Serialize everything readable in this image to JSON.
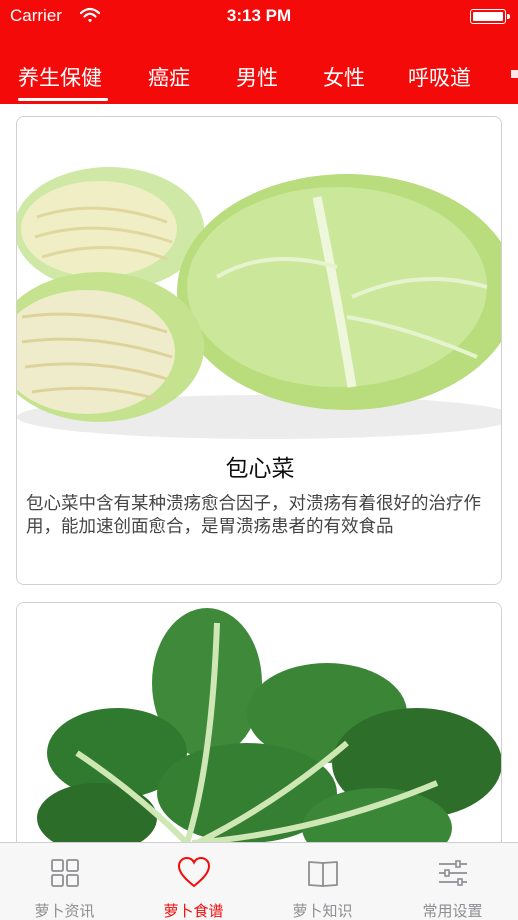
{
  "status_bar": {
    "carrier": "Carrier",
    "time": "3:13 PM"
  },
  "category_tabs": [
    {
      "label": "养生保健",
      "selected": true
    },
    {
      "label": "癌症",
      "selected": false
    },
    {
      "label": "男性",
      "selected": false
    },
    {
      "label": "女性",
      "selected": false
    },
    {
      "label": "呼吸道",
      "selected": false
    }
  ],
  "cards": [
    {
      "title": "包心菜",
      "description": "包心菜中含有某种溃疡愈合因子，对溃疡有着很好的治疗作用，能加速创面愈合，是胃溃疡患者的有效食品",
      "image_subject": "cabbage"
    },
    {
      "title": "",
      "description": "",
      "image_subject": "spinach"
    }
  ],
  "tab_bar": [
    {
      "label": "萝卜资讯",
      "icon": "grid-icon",
      "active": false
    },
    {
      "label": "萝卜食谱",
      "icon": "heart-icon",
      "active": true
    },
    {
      "label": "萝卜知识",
      "icon": "book-icon",
      "active": false
    },
    {
      "label": "常用设置",
      "icon": "sliders-icon",
      "active": false
    }
  ],
  "colors": {
    "accent": "#f50a0a",
    "tab_inactive": "#8e8e93",
    "card_border": "#d0d0d0"
  }
}
